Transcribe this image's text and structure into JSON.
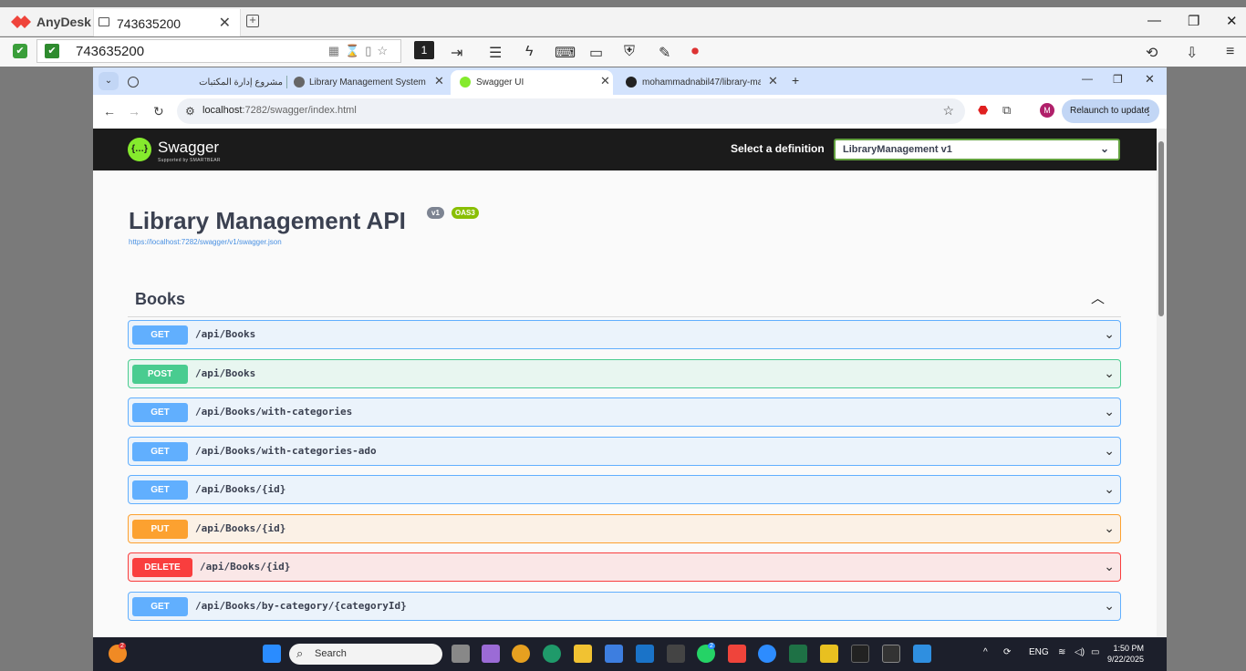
{
  "anydesk": {
    "app_name": "AnyDesk",
    "tab_label": "743635200",
    "tab_close": "✕",
    "new_tab": "+",
    "address_value": "743635200",
    "monitor_number": "1",
    "window_controls": {
      "minimize": "—",
      "maximize": "❐",
      "close": "✕"
    }
  },
  "chrome": {
    "tabs": [
      {
        "label": "مشروع إدارة المكتبات",
        "favicon": "openai-icon"
      },
      {
        "label": "Library Management System",
        "favicon": "globe-icon"
      },
      {
        "label": "Swagger UI",
        "favicon": "swagger-icon",
        "active": true
      },
      {
        "label": "mohammadnabil47/library-mar",
        "favicon": "github-icon"
      }
    ],
    "tab_close": "✕",
    "new_tab": "+",
    "url_host": "localhost",
    "url_rest": ":7282/swagger/index.html",
    "profile_initial": "M",
    "relaunch_label": "Relaunch to update",
    "window_controls": {
      "minimize": "—",
      "maximize": "❐",
      "close": "✕"
    }
  },
  "swagger": {
    "brand": "Swagger",
    "brand_sub": "Supported by SMARTBEAR",
    "select_label": "Select a definition",
    "selected_definition": "LibraryManagement v1",
    "api_title": "Library Management API",
    "version_badge": "v1",
    "oas_badge": "OAS3",
    "json_link": "https://localhost:7282/swagger/v1/swagger.json",
    "tag": "Books",
    "operations": [
      {
        "method": "GET",
        "path": "/api/Books"
      },
      {
        "method": "POST",
        "path": "/api/Books"
      },
      {
        "method": "GET",
        "path": "/api/Books/with-categories"
      },
      {
        "method": "GET",
        "path": "/api/Books/with-categories-ado"
      },
      {
        "method": "GET",
        "path": "/api/Books/{id}"
      },
      {
        "method": "PUT",
        "path": "/api/Books/{id}"
      },
      {
        "method": "DELETE",
        "path": "/api/Books/{id}"
      },
      {
        "method": "GET",
        "path": "/api/Books/by-category/{categoryId}"
      }
    ],
    "colors": {
      "get": "#61affe",
      "post": "#49cc90",
      "put": "#fca130",
      "delete": "#f93e3e"
    }
  },
  "taskbar": {
    "search_placeholder": "Search",
    "weather_badge": "2",
    "whatsapp_badge": "2",
    "language": "ENG",
    "time": "1:50 PM",
    "date": "9/22/2025"
  }
}
